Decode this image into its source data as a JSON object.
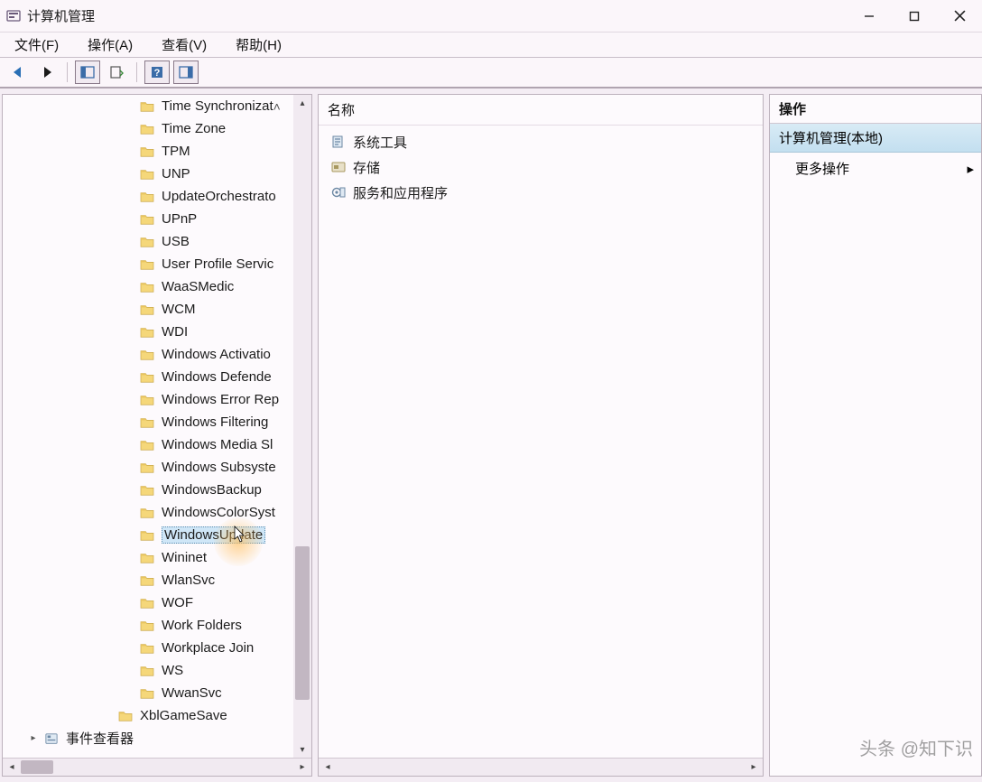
{
  "window": {
    "title": "计算机管理"
  },
  "menu": {
    "file": "文件(F)",
    "action": "操作(A)",
    "view": "查看(V)",
    "help": "帮助(H)"
  },
  "tree": {
    "items": [
      {
        "label": "Time Synchronizat",
        "depth": 4
      },
      {
        "label": "Time Zone",
        "depth": 4
      },
      {
        "label": "TPM",
        "depth": 4
      },
      {
        "label": "UNP",
        "depth": 4
      },
      {
        "label": "UpdateOrchestrato",
        "depth": 4
      },
      {
        "label": "UPnP",
        "depth": 4
      },
      {
        "label": "USB",
        "depth": 4
      },
      {
        "label": "User Profile Servic",
        "depth": 4
      },
      {
        "label": "WaaSMedic",
        "depth": 4
      },
      {
        "label": "WCM",
        "depth": 4
      },
      {
        "label": "WDI",
        "depth": 4
      },
      {
        "label": "Windows Activatio",
        "depth": 4
      },
      {
        "label": "Windows Defende",
        "depth": 4
      },
      {
        "label": "Windows Error Rep",
        "depth": 4
      },
      {
        "label": "Windows Filtering",
        "depth": 4
      },
      {
        "label": "Windows Media Sl",
        "depth": 4
      },
      {
        "label": "Windows Subsyste",
        "depth": 4
      },
      {
        "label": "WindowsBackup",
        "depth": 4
      },
      {
        "label": "WindowsColorSyst",
        "depth": 4
      },
      {
        "label": "WindowsUpdate",
        "depth": 4,
        "selected": true
      },
      {
        "label": "Wininet",
        "depth": 4
      },
      {
        "label": "WlanSvc",
        "depth": 4
      },
      {
        "label": "WOF",
        "depth": 4
      },
      {
        "label": "Work Folders",
        "depth": 4
      },
      {
        "label": "Workplace Join",
        "depth": 4
      },
      {
        "label": "WS",
        "depth": 4
      },
      {
        "label": "WwanSvc",
        "depth": 4
      },
      {
        "label": "XblGameSave",
        "depth": 3
      }
    ],
    "event_viewer": "事件查看器"
  },
  "middle": {
    "column_header": "名称",
    "rows": [
      {
        "icon": "tools",
        "label": "系统工具"
      },
      {
        "icon": "storage",
        "label": "存储"
      },
      {
        "icon": "services",
        "label": "服务和应用程序"
      }
    ]
  },
  "right": {
    "header": "操作",
    "section_title": "计算机管理(本地)",
    "more_actions": "更多操作"
  },
  "watermark": "头条 @知下识"
}
